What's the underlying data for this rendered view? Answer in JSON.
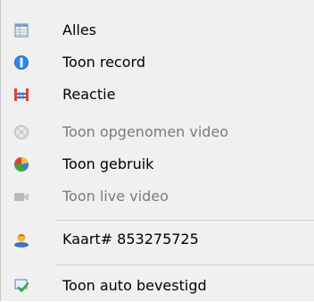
{
  "menu": {
    "items": [
      {
        "label": "Alles",
        "icon": "table-icon",
        "enabled": true
      },
      {
        "label": "Toon record",
        "icon": "info-icon",
        "enabled": true
      },
      {
        "label": "Reactie",
        "icon": "reaction-icon",
        "enabled": true
      },
      {
        "label": "Toon opgenomen video",
        "icon": "film-reel-icon",
        "enabled": false
      },
      {
        "label": "Toon gebruik",
        "icon": "pie-chart-icon",
        "enabled": true
      },
      {
        "label": "Toon live video",
        "icon": "video-camera-icon",
        "enabled": false
      },
      {
        "label": "Kaart# 853275725",
        "icon": "user-icon",
        "enabled": true
      },
      {
        "label": "Toon auto bevestigd",
        "icon": "auto-confirm-icon",
        "enabled": true
      }
    ]
  },
  "colors": {
    "menu_background": "#f0f0f0",
    "text": "#000000",
    "disabled_text": "#7a7a7a",
    "separator": "#d0d0d0"
  }
}
